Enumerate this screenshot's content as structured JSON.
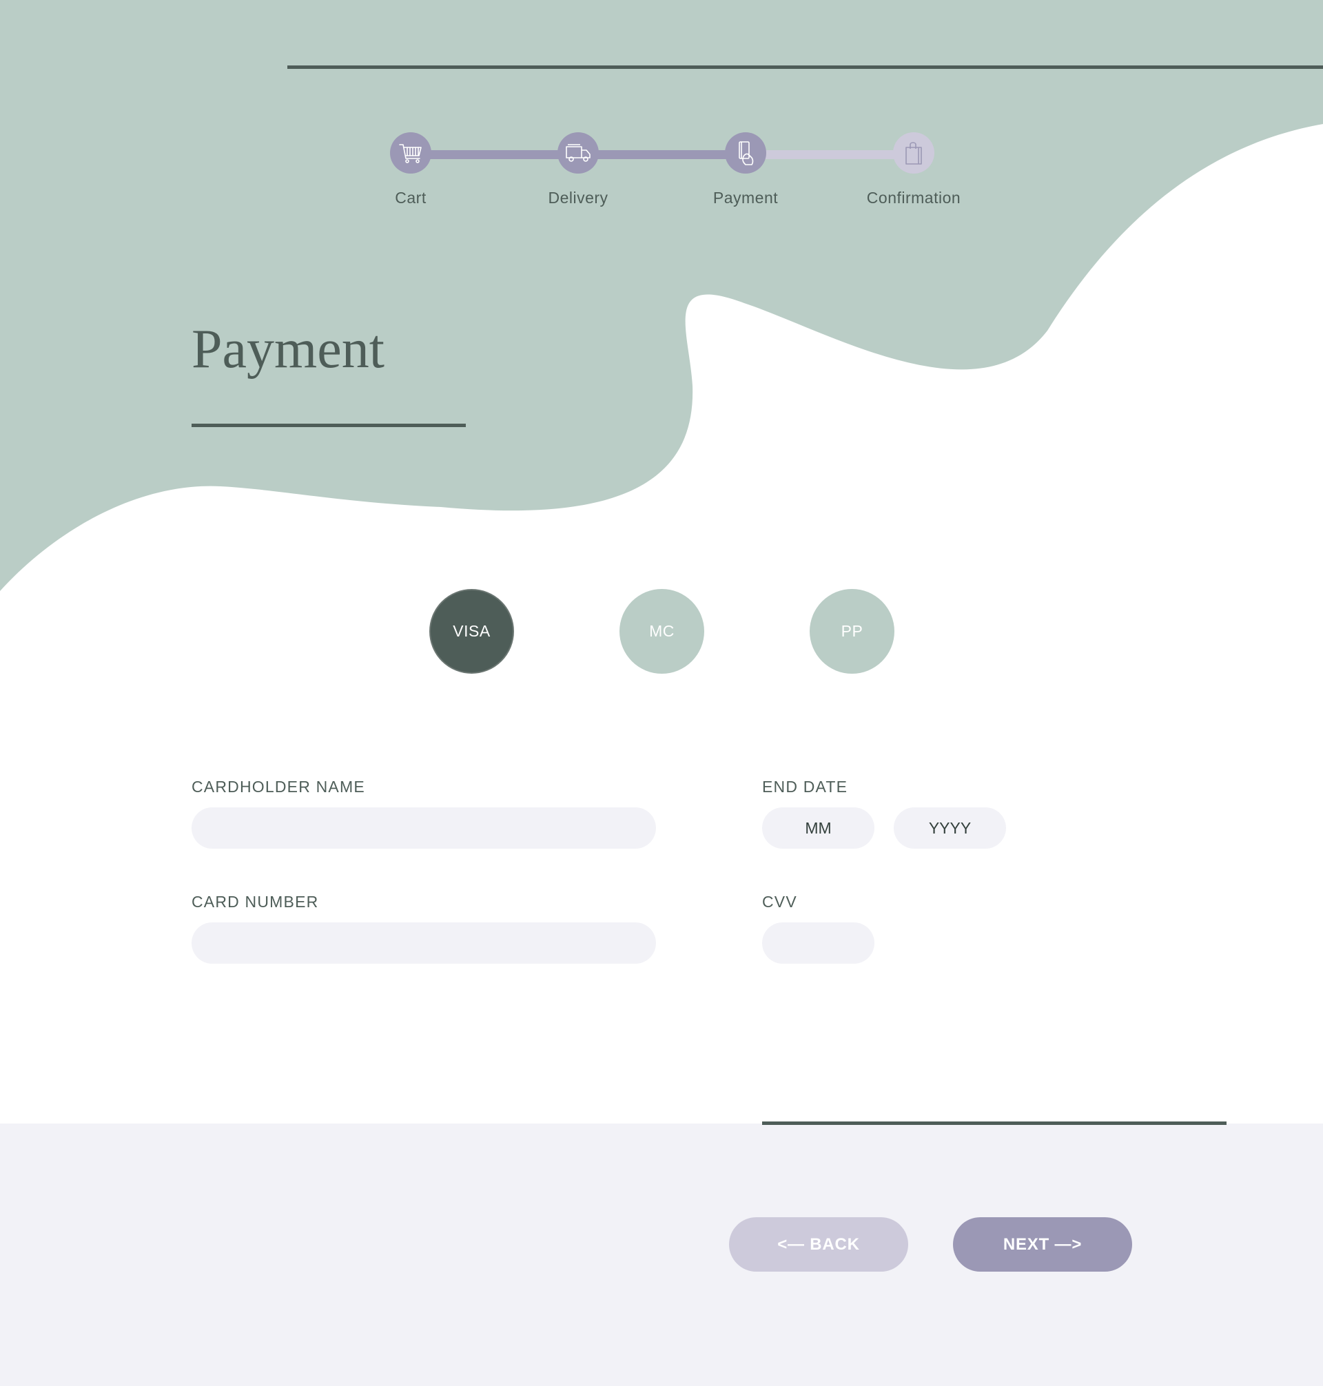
{
  "colors": {
    "sage": "#bacdc6",
    "dark": "#4e5d58",
    "lavender": "#9b98b5",
    "lavender_light": "#cdcadb",
    "field_bg": "#f2f2f7"
  },
  "progress": {
    "current_step": 3,
    "steps": [
      {
        "label": "Cart",
        "icon": "cart-icon",
        "state": "done"
      },
      {
        "label": "Delivery",
        "icon": "truck-icon",
        "state": "done"
      },
      {
        "label": "Payment",
        "icon": "card-in-hand-icon",
        "state": "done"
      },
      {
        "label": "Confirmation",
        "icon": "shopping-bag-icon",
        "state": "todo"
      }
    ]
  },
  "page": {
    "title": "Payment"
  },
  "payment_methods": [
    {
      "label": "VISA",
      "selected": true
    },
    {
      "label": "MC",
      "selected": false
    },
    {
      "label": "PP",
      "selected": false
    }
  ],
  "form": {
    "cardholder_label": "CARDHOLDER NAME",
    "cardholder_value": "",
    "card_number_label": "CARD NUMBER",
    "card_number_value": "",
    "end_date_label": "END DATE",
    "month_placeholder": "MM",
    "year_placeholder": "YYYY",
    "cvv_label": "CVV",
    "cvv_value": ""
  },
  "buttons": {
    "back": "<— BACK",
    "next": "NEXT —>"
  }
}
